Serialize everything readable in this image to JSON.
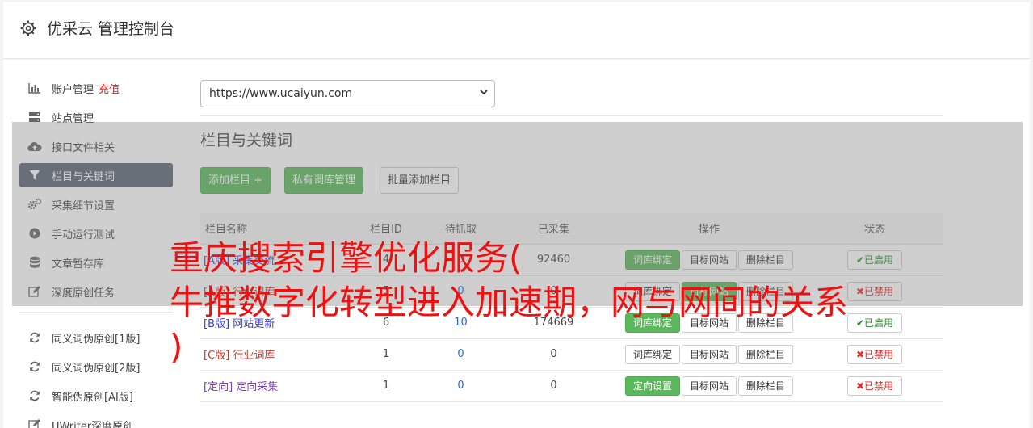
{
  "header": {
    "title": "优采云 管理控制台"
  },
  "sidebar": {
    "items": [
      {
        "label": "账户管理",
        "extra": "充值",
        "icon": "bar-chart-icon"
      },
      {
        "label": "站点管理",
        "icon": "server-icon"
      },
      {
        "label": "接口文件相关",
        "icon": "cloud-upload-icon"
      },
      {
        "label": "栏目与关键词",
        "icon": "filter-icon",
        "active": true
      },
      {
        "label": "采集细节设置",
        "icon": "gears-icon"
      },
      {
        "label": "手动运行测试",
        "icon": "play-circle-icon"
      },
      {
        "label": "文章暂存库",
        "icon": "database-icon"
      },
      {
        "label": "深度原创任务",
        "icon": "edit-icon"
      }
    ],
    "tools": [
      {
        "label": "同义词伪原创[1版]",
        "icon": "refresh-icon"
      },
      {
        "label": "同义词伪原创[2版]",
        "icon": "refresh-icon"
      },
      {
        "label": "智能伪原创[AI版]",
        "icon": "refresh-icon"
      },
      {
        "label": "UWriter深度原创",
        "icon": "edit-icon"
      }
    ]
  },
  "site_select": {
    "value": "https://www.ucaiyun.com"
  },
  "section": {
    "title": "栏目与关键词"
  },
  "toolbar": {
    "add_column": "添加栏目 +",
    "private_lib": "私有词库管理",
    "batch_add": "批量添加栏目"
  },
  "table": {
    "headers": [
      "栏目名称",
      "栏目ID",
      "待抓取",
      "已采集",
      "操作",
      "状态"
    ],
    "rows": [
      {
        "tag": "[A版]",
        "name": "采集交流",
        "id": "4",
        "pending": "0",
        "collected": "92460",
        "op1": "词库绑定",
        "op2": "目标网站",
        "op3": "删除栏目",
        "status": "✔已启用",
        "enabled": true
      },
      {
        "tag": "[A版]",
        "name": "行业词库",
        "id": "5",
        "pending": "0",
        "collected": "0",
        "op1": "词库绑定",
        "op2": "目标网站",
        "op3": "删除栏目",
        "status": "✖已禁用",
        "enabled": false
      },
      {
        "tag": "[B版]",
        "name": "网站更新",
        "id": "6",
        "pending": "10",
        "collected": "174669",
        "op1": "词库绑定",
        "op2": "目标网站",
        "op3": "删除栏目",
        "status": "✔已启用",
        "enabled": true
      },
      {
        "tag": "[C版]",
        "name": "行业词库",
        "id": "1",
        "pending": "0",
        "collected": "0",
        "op1": "词库绑定",
        "op2": "目标网站",
        "op3": "删除栏目",
        "status": "✖已禁用",
        "enabled": false
      },
      {
        "tag": "[定向]",
        "name": "定向采集",
        "id": "1",
        "pending": "0",
        "collected": "0",
        "op1": "定向设置",
        "op2": "目标网站",
        "op3": "删除栏目",
        "status": "✖已禁用",
        "enabled": false
      }
    ]
  },
  "watermark": {
    "line1": "重庆搜索引擎优化服务(",
    "line2": "牛推数字化转型进入加速期，网与网间的关系",
    "line3": ")"
  }
}
